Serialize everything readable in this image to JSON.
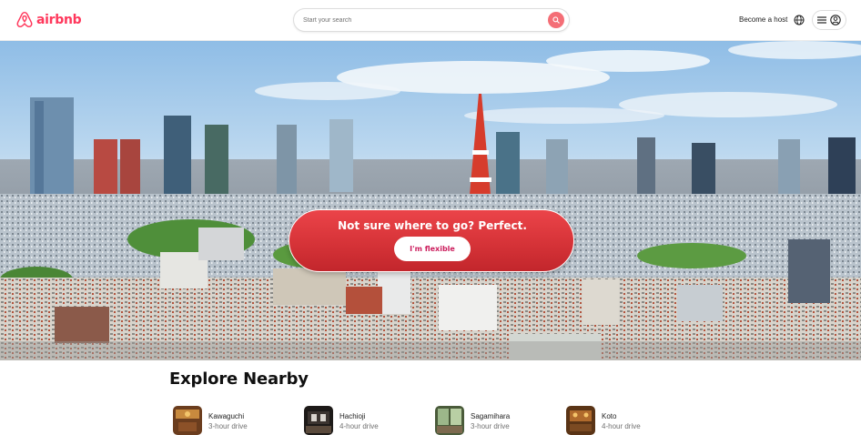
{
  "header": {
    "logo_text": "airbnb",
    "search_placeholder": "Start your search",
    "become_host": "Become a host"
  },
  "hero": {
    "title": "Not sure where to go? Perfect.",
    "button_label": "I'm flexible"
  },
  "explore": {
    "title": "Explore Nearby",
    "items": [
      {
        "name": "Kawaguchi",
        "drive": "3-hour drive"
      },
      {
        "name": "Hachioji",
        "drive": "4-hour drive"
      },
      {
        "name": "Sagamihara",
        "drive": "3-hour drive"
      },
      {
        "name": "Koto",
        "drive": "4-hour drive"
      }
    ]
  },
  "colors": {
    "brand": "#ff385c",
    "cta": "#d63338",
    "search_button": "#f46e76"
  },
  "icons": [
    "airbnb-logo-icon",
    "search-icon",
    "globe-icon",
    "hamburger-icon",
    "user-icon"
  ]
}
